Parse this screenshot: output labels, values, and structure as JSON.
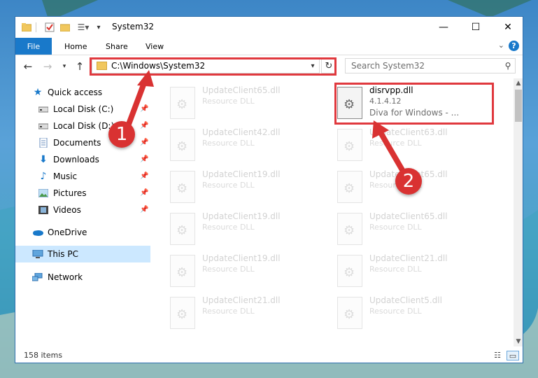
{
  "window": {
    "title": "System32",
    "controls": {
      "minimize": "—",
      "maximize": "☐",
      "close": "✕"
    }
  },
  "ribbon": {
    "file": "File",
    "tabs": [
      "Home",
      "Share",
      "View"
    ],
    "help": "?"
  },
  "address": {
    "path": "C:\\Windows\\System32",
    "search_placeholder": "Search System32"
  },
  "nav_pane": {
    "quick_access": "Quick access",
    "quick_items": [
      {
        "label": "Local Disk (C:)",
        "icon": "drive-icon"
      },
      {
        "label": "Local Disk (D:)",
        "icon": "drive-icon"
      },
      {
        "label": "Documents",
        "icon": "documents-icon"
      },
      {
        "label": "Downloads",
        "icon": "downloads-icon"
      },
      {
        "label": "Music",
        "icon": "music-icon"
      },
      {
        "label": "Pictures",
        "icon": "pictures-icon"
      },
      {
        "label": "Videos",
        "icon": "videos-icon"
      }
    ],
    "onedrive": "OneDrive",
    "this_pc": "This PC",
    "network": "Network"
  },
  "files": {
    "left_column": [
      {
        "name": "UpdateClient65.dll",
        "type": "Resource DLL"
      },
      {
        "name": "UpdateClient42.dll",
        "type": "Resource DLL"
      },
      {
        "name": "UpdateClient19.dll",
        "type": "Resource DLL"
      },
      {
        "name": "UpdateClient19.dll",
        "type": "Resource DLL"
      },
      {
        "name": "UpdateClient19.dll",
        "type": "Resource DLL"
      },
      {
        "name": "UpdateClient21.dll",
        "type": "Resource DLL"
      }
    ],
    "selected": {
      "name": "disrvpp.dll",
      "version": "4.1.4.12",
      "description": "Diva for Windows - ..."
    },
    "right_column": [
      {
        "name": "UpdateClient63.dll",
        "type": "Resource DLL"
      },
      {
        "name": "UpdateClient65.dll",
        "type": "Resource DLL"
      },
      {
        "name": "UpdateClient65.dll",
        "type": "Resource DLL"
      },
      {
        "name": "UpdateClient21.dll",
        "type": "Resource DLL"
      },
      {
        "name": "UpdateClient5.dll",
        "type": "Resource DLL"
      }
    ]
  },
  "status": {
    "item_count": "158 items"
  },
  "annotations": {
    "step1": "1",
    "step2": "2"
  },
  "colors": {
    "accent": "#1979ca",
    "annotation_red": "#e0393e",
    "selection": "#cce8ff"
  }
}
